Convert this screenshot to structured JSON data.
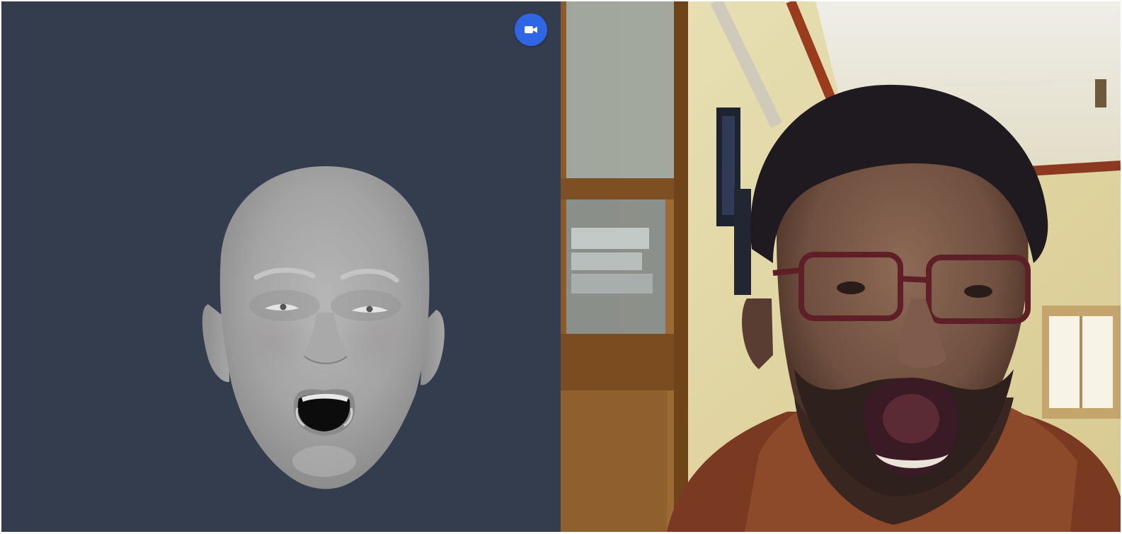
{
  "avatar_panel": {
    "background": "#343d4e",
    "model": "3d-head-model",
    "expression": "mouth-open"
  },
  "camera_toggle": {
    "icon": "video-camera-icon",
    "color": "#2f66e5"
  },
  "webcam_panel": {
    "content": "webcam-feed"
  }
}
